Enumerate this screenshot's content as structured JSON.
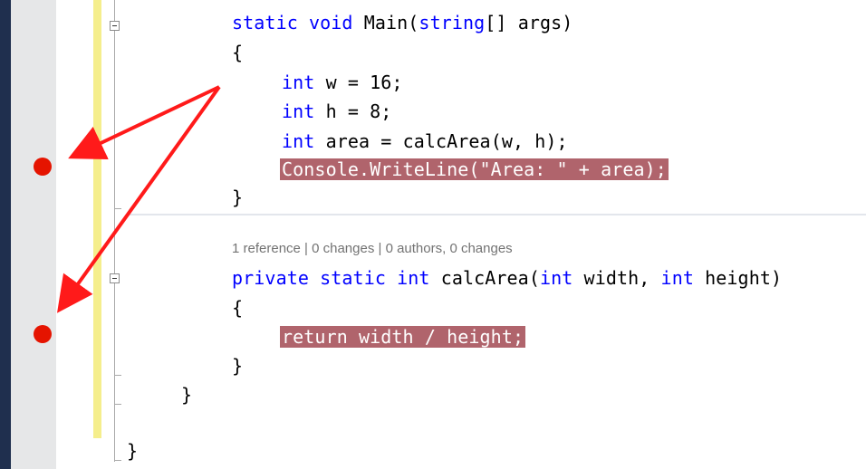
{
  "editor": {
    "lines": {
      "main_signature": {
        "kw1": "static void ",
        "name": "Main(",
        "kw2": "string",
        "rest": "[] args)"
      },
      "open_brace_1": "{",
      "decl_w": {
        "kw": "int",
        "rest": " w = 16;"
      },
      "decl_h": {
        "kw": "int",
        "rest": " h = 8;"
      },
      "decl_area": {
        "kw": "int",
        "rest": " area = calcArea(w, h);"
      },
      "console_line": "Console.WriteLine(\"Area: \" + area);",
      "close_brace_1": "}",
      "codelens": "1 reference | 0 changes | 0 authors, 0 changes",
      "calc_signature": {
        "kw1": "private static int ",
        "name": "calcArea(",
        "kw2": "int",
        "mid": " width, ",
        "kw3": "int",
        "rest": " height)"
      },
      "open_brace_2": "{",
      "return_line": "return width / height;",
      "close_brace_2": "}",
      "close_brace_class": "}",
      "close_brace_namespace": "}"
    },
    "breakpoints": [
      "line-console-writeline",
      "line-return"
    ],
    "colors": {
      "keyword": "#0000ff",
      "breakpoint": "#e51400",
      "breakpoint_highlight": "#b0646c",
      "annotation_arrow": "#ff1a1a"
    }
  }
}
